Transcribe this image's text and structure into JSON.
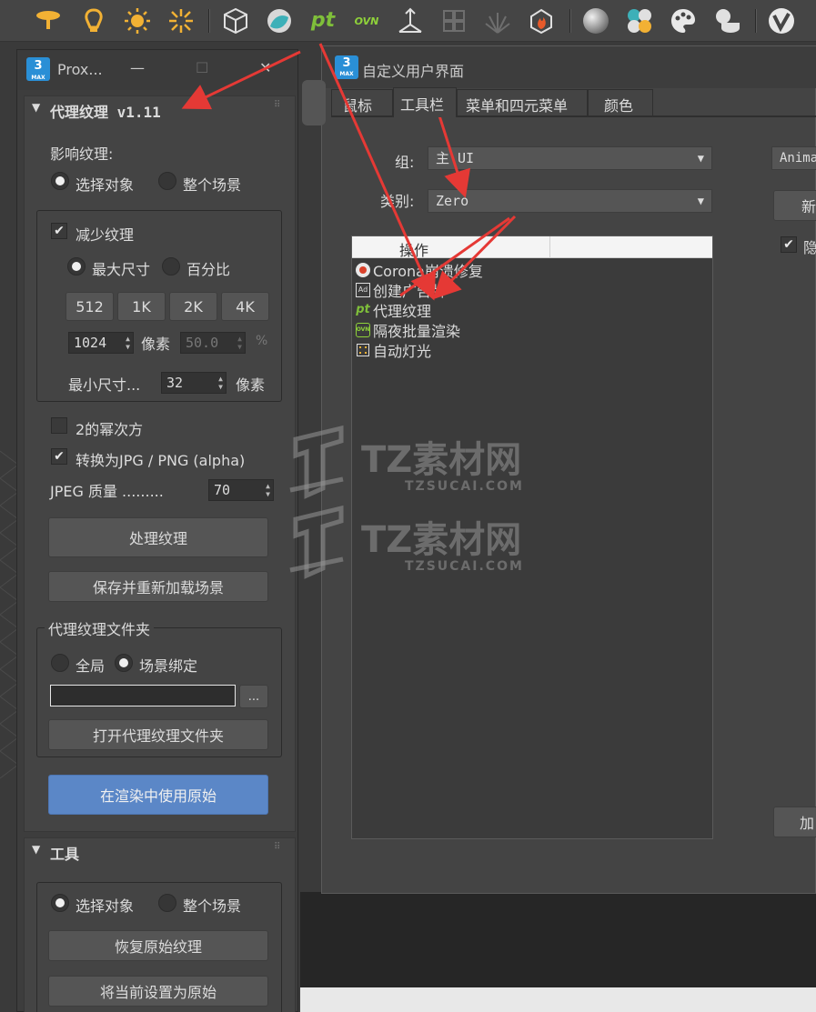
{
  "toolbar": {
    "icons": [
      "light-cone-icon",
      "bulb-icon",
      "sun-icon",
      "sunburst-icon",
      "box-icon",
      "material-ball-icon",
      "pt-icon",
      "ovn-icon",
      "tripod-icon",
      "grid-icon",
      "grass-icon",
      "fire-icon",
      "sphere-icon",
      "palette-dots-icon",
      "paint-palette-icon",
      "pot-icon",
      "vray-icon"
    ],
    "pt_label": "pt",
    "ovn_label": "OVN"
  },
  "proxy_window": {
    "title": "Prox...",
    "minimize": "—",
    "maximize": "☐",
    "close": "✕",
    "rollout1": {
      "header": "代理纹理  v1.11",
      "affect_label": "影响纹理:",
      "radio_selected": "选择对象",
      "radio_scene": "整个场景",
      "reduce_check": "减少纹理",
      "max_size": "最大尺寸",
      "percent": "百分比",
      "size_buttons": [
        "512",
        "1K",
        "2K",
        "4K"
      ],
      "px_value": "1024",
      "px_unit": "像素",
      "pct_value": "50.0",
      "pct_unit": "%",
      "min_size_label": "最小尺寸...",
      "min_size_value": "32",
      "min_size_unit": "像素",
      "power_of_two": "2的幂次方",
      "convert_jpg": "转换为JPG / PNG (alpha)",
      "jpeg_quality_label": "JPEG 质量 .........",
      "jpeg_quality_value": "70",
      "process_button": "处理纹理",
      "save_reload_button": "保存并重新加载场景",
      "folder_group": "代理纹理文件夹",
      "global_radio": "全局",
      "scene_bound_radio": "场景绑定",
      "path_value": "",
      "browse_button": "...",
      "open_folder_button": "打开代理纹理文件夹",
      "use_original_button": "在渲染中使用原始"
    },
    "rollout2": {
      "header": "工具",
      "radio_selected": "选择对象",
      "radio_scene": "整个场景",
      "restore_button": "恢复原始纹理",
      "set_original_button": "将当前设置为原始"
    }
  },
  "customize_window": {
    "title": "自定义用户界面",
    "app_badge": "3",
    "app_badge_sub": "MAX",
    "tabs": [
      "鼠标",
      "工具栏",
      "菜单和四元菜单",
      "颜色"
    ],
    "active_tab": 1,
    "group_label": "组:",
    "group_value": "主 UI",
    "category_label": "类别:",
    "category_value": "Zero",
    "list_header": "操作",
    "actions": [
      "Corona崩溃修复",
      "创建广告牌",
      "代理纹理",
      "隔夜批量渲染",
      "自动灯光"
    ],
    "right_dropdown": "Anima",
    "new_button": "新",
    "hide_check": "隐",
    "add_button": "加"
  },
  "watermark": {
    "brand": "TZ素材网",
    "url": "TZSUCAI.COM"
  }
}
